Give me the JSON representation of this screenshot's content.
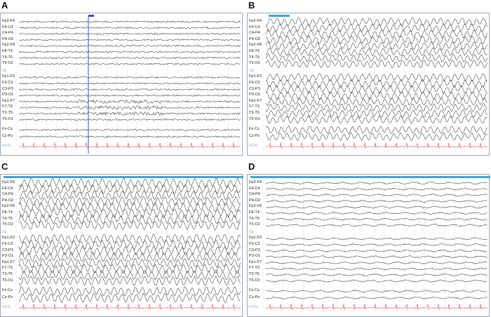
{
  "colors": {
    "eeg": "#3a3a3a",
    "ecg": "#e23b3b",
    "grid": "#e7e9ee",
    "marker": "#3da6d6",
    "cursor": "#3b4fc9"
  },
  "channels": [
    "Fp2-F4",
    "F4-C4",
    "C4-P4",
    "P4-O2",
    "Fp2-F8",
    "F8-T4",
    "T4-T5",
    "T5-O2",
    "Fp1-F3",
    "F3-C3",
    "C3-P3",
    "P3-O1",
    "Fp1-F7",
    "F7-T3",
    "T3-T5",
    "T5-O1",
    "Fz-Cz",
    "Cz-Pz"
  ],
  "separator_label": "Sij",
  "ecg_label": "ECG",
  "panels": [
    {
      "letter": "A",
      "pattern": "normal",
      "amplitude": 0.18,
      "cursor": true
    },
    {
      "letter": "B",
      "pattern": "seizure",
      "amplitude": 0.65,
      "cursor": false
    },
    {
      "letter": "C",
      "pattern": "seizure",
      "amplitude": 0.75,
      "cursor": false
    },
    {
      "letter": "D",
      "pattern": "postictal",
      "amplitude": 0.25,
      "cursor": false
    }
  ]
}
